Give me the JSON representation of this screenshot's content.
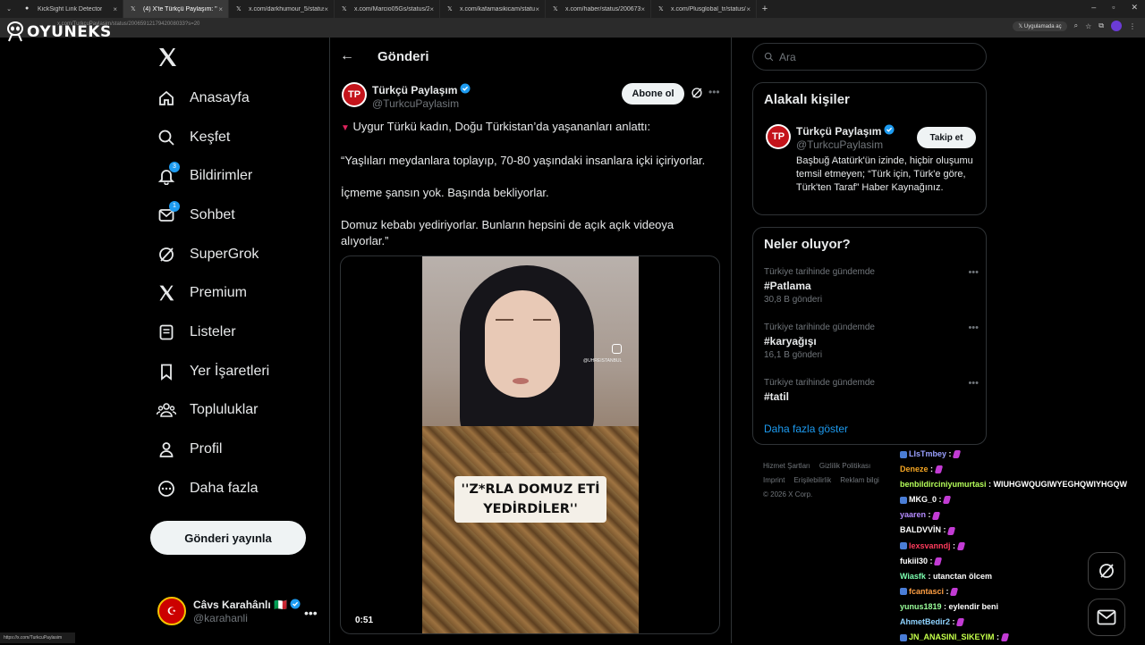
{
  "browser": {
    "tabs": [
      {
        "title": "KickSight Link Detector",
        "active": false
      },
      {
        "title": "(4) X'te Türkçü Paylaşım: \"",
        "active": true
      },
      {
        "title": "x.com/darkhumour_5/status/2",
        "active": false
      },
      {
        "title": "x.com/Marcio05Gs/status/200",
        "active": false
      },
      {
        "title": "x.com/kafamasikicam/status/2",
        "active": false
      },
      {
        "title": "x.com/haber/status/2006734",
        "active": false
      },
      {
        "title": "x.com/Plusglobal_tr/status/200",
        "active": false
      }
    ],
    "url": "x.com/TurkcuPaylasim/status/2006591217942008033?s=20",
    "app_button": "Uygulamada aç",
    "status_url": "https://x.com/TurkcuPaylasim"
  },
  "overlay": {
    "logo": "OYUNEKS"
  },
  "nav": {
    "items": [
      {
        "label": "Anasayfa",
        "icon": "home-icon"
      },
      {
        "label": "Keşfet",
        "icon": "search-icon"
      },
      {
        "label": "Bildirimler",
        "icon": "bell-icon",
        "badge": "3"
      },
      {
        "label": "Sohbet",
        "icon": "mail-icon",
        "badge": "1"
      },
      {
        "label": "SuperGrok",
        "icon": "grok-icon"
      },
      {
        "label": "Premium",
        "icon": "x-icon"
      },
      {
        "label": "Listeler",
        "icon": "list-icon"
      },
      {
        "label": "Yer İşaretleri",
        "icon": "bookmark-icon"
      },
      {
        "label": "Topluluklar",
        "icon": "people-icon"
      },
      {
        "label": "Profil",
        "icon": "user-icon"
      },
      {
        "label": "Daha fazla",
        "icon": "more-circle-icon"
      }
    ],
    "post_button": "Gönderi yayınla",
    "account": {
      "name": "Câvs Karahânlı 🇮🇹",
      "handle": "@karahanli"
    }
  },
  "post": {
    "page_title": "Gönderi",
    "author_name": "Türkçü Paylaşım",
    "author_handle": "@TurkcuPaylasim",
    "subscribe_button": "Abone ol",
    "body": [
      "Uygur Türkü kadın, Doğu Türkistan’da yaşananları anlattı:",
      "“Yaşlıları meydanlara toplayıp, 70-80 yaşındaki insanlara içki içiriyorlar.",
      "İçmeme şansın yok. Başında bekliyorlar.",
      "Domuz kebabı yediriyorlar. Bunların hepsini de açık açık videoya alıyorlar.”"
    ],
    "video_caption_line1": "''Z*RLA DOMUZ ETİ",
    "video_caption_line2": "YEDİRDİLER''",
    "video_watermark": "@UHREISTANBUL",
    "video_duration": "0:51"
  },
  "right": {
    "search_placeholder": "Ara",
    "related_title": "Alakalı kişiler",
    "related": {
      "name": "Türkçü Paylaşım",
      "handle": "@TurkcuPaylasim",
      "follow_button": "Takip et",
      "bio": "Başbuğ Atatürk'ün izinde, hiçbir oluşumu temsil etmeyen; “Türk için, Türk'e göre, Türk'ten Taraf” Haber Kaynağınız."
    },
    "trends_title": "Neler oluyor?",
    "trends": [
      {
        "context": "Türkiye tarihinde gündemde",
        "tag": "#Patlama",
        "count": "30,8 B gönderi"
      },
      {
        "context": "Türkiye tarihinde gündemde",
        "tag": "#karyağışı",
        "count": "16,1 B gönderi"
      },
      {
        "context": "Türkiye tarihinde gündemde",
        "tag": "#tatil",
        "count": ""
      }
    ],
    "show_more": "Daha fazla göster",
    "footer_line1a": "Hizmet Şartları",
    "footer_line1b": "Gizlilik Politikası",
    "footer_line2a": "Imprint",
    "footer_line2b": "Erişilebilirlik",
    "footer_line2c": "Reklam bilgi",
    "footer_copy": "© 2026 X Corp."
  },
  "chat": [
    {
      "user": "LIsTmbey",
      "color": "#9aa0ff",
      "msg": "",
      "emote": true
    },
    {
      "user": "Deneze",
      "color": "#f5a623",
      "msg": "",
      "emote": true
    },
    {
      "user": "benbildirciniyumurtasi",
      "color": "#b6ff5a",
      "msg": "WIUHGWQUGIWYEGHQWIYHGQW",
      "emote": false
    },
    {
      "user": "MKG_0",
      "color": "#ffffff",
      "msg": "",
      "emote": true
    },
    {
      "user": "yaaren",
      "color": "#b58bff",
      "msg": "",
      "emote": true
    },
    {
      "user": "BALDVVİN",
      "color": "#ffffff",
      "msg": "",
      "emote": true
    },
    {
      "user": "lexsvanndj",
      "color": "#ff3b5c",
      "msg": "",
      "emote": true
    },
    {
      "user": "fukiil30",
      "color": "#ffffff",
      "msg": "",
      "emote": true
    },
    {
      "user": "Wiasfk",
      "color": "#7cffb0",
      "msg": "utanctan ölcem",
      "emote": false
    },
    {
      "user": "fcantasci",
      "color": "#ff9f43",
      "msg": "",
      "emote": true
    },
    {
      "user": "yunus1819",
      "color": "#9aff9a",
      "msg": "eylendir beni",
      "emote": false
    },
    {
      "user": "AhmetBedir2",
      "color": "#8fd3ff",
      "msg": "",
      "emote": true
    },
    {
      "user": "JN_ANASINI_SIKEYIM",
      "color": "#c4ff4a",
      "msg": "",
      "emote": true
    }
  ]
}
